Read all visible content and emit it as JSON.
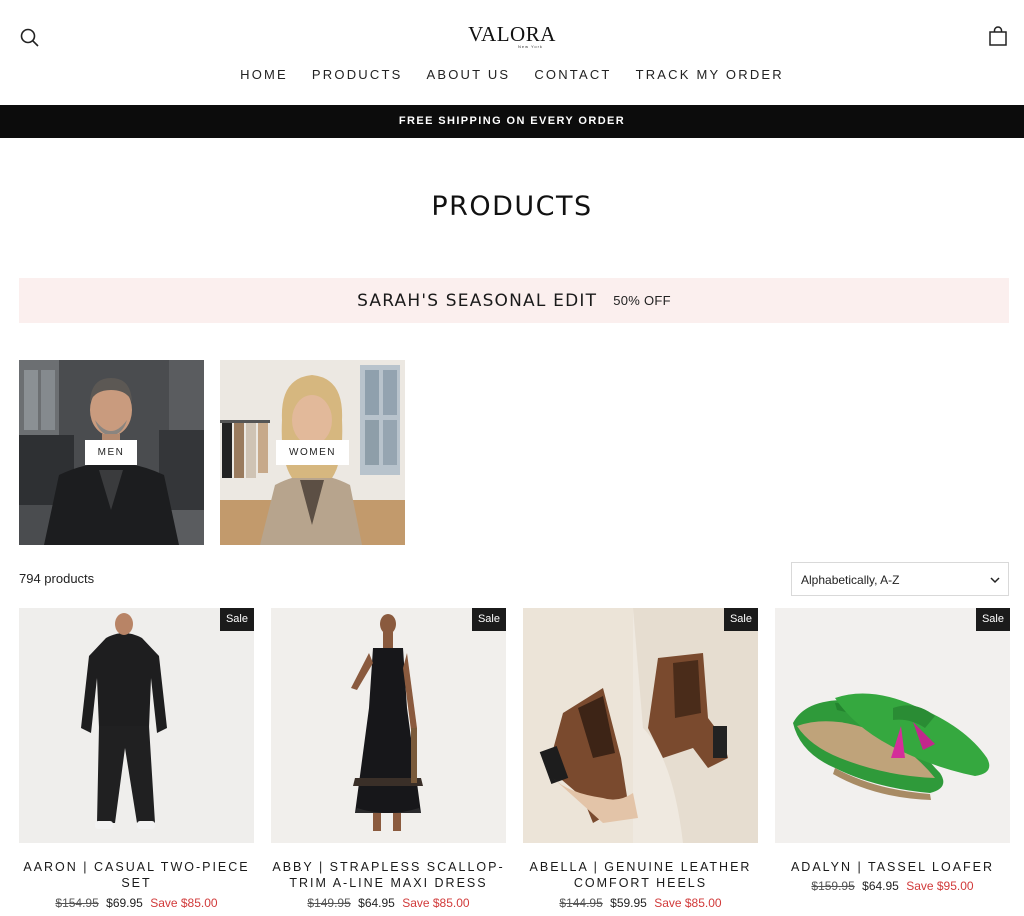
{
  "header": {
    "logo_text": "VALORA",
    "logo_sub": "New York",
    "nav": [
      "HOME",
      "PRODUCTS",
      "ABOUT US",
      "CONTACT",
      "TRACK MY ORDER"
    ]
  },
  "announcement": "FREE SHIPPING ON EVERY ORDER",
  "page_title": "PRODUCTS",
  "promo": {
    "title": "SARAH'S SEASONAL EDIT",
    "discount": "50% OFF"
  },
  "collections": [
    {
      "label": "MEN"
    },
    {
      "label": "WOMEN"
    }
  ],
  "toolbar": {
    "count": "794 products",
    "sort_selected": "Alphabetically, A-Z"
  },
  "products": [
    {
      "badge": "Sale",
      "title": "AARON | CASUAL TWO-PIECE SET",
      "old_price": "$154.95",
      "price": "$69.95",
      "save": "Save $85.00"
    },
    {
      "badge": "Sale",
      "title": "ABBY | STRAPLESS SCALLOP-TRIM A-LINE MAXI DRESS",
      "old_price": "$149.95",
      "price": "$64.95",
      "save": "Save $85.00"
    },
    {
      "badge": "Sale",
      "title": "ABELLA | GENUINE LEATHER COMFORT HEELS",
      "old_price": "$144.95",
      "price": "$59.95",
      "save": "Save $85.00"
    },
    {
      "badge": "Sale",
      "title": "ADALYN | TASSEL LOAFER",
      "old_price": "$159.95",
      "price": "$64.95",
      "save": "Save $95.00"
    }
  ],
  "colors": {
    "announcement_bg": "#0c0c0c",
    "promo_bg": "#fbefee",
    "sale_red": "#d13a3a",
    "badge_bg": "#1b1b1b"
  },
  "icons": {
    "search": "search-icon",
    "cart": "bag-icon",
    "sort": "chevron-down-icon"
  }
}
